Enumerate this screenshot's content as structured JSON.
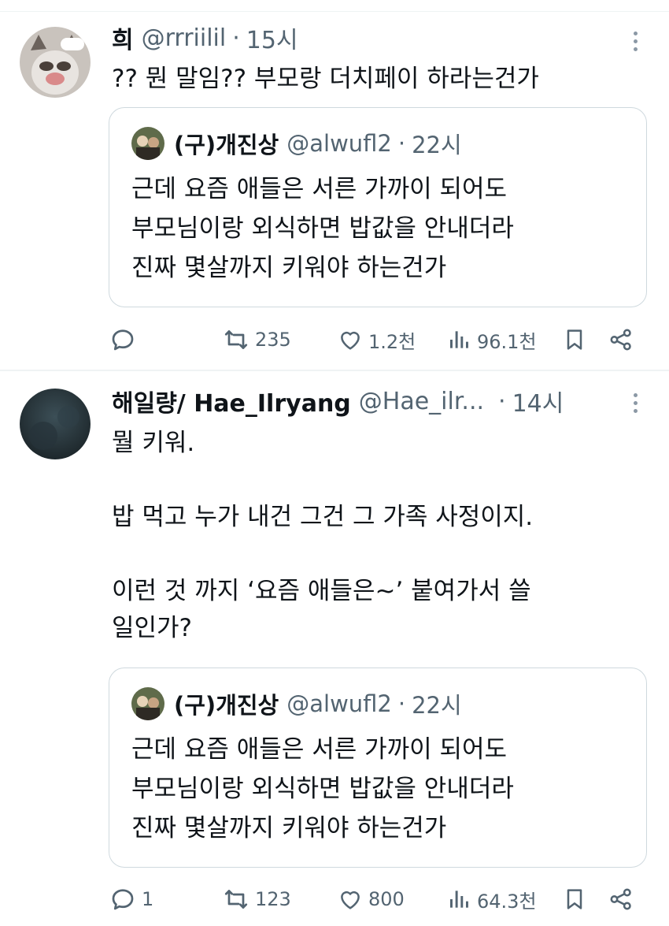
{
  "colors": {
    "text": "#0f1419",
    "secondary": "#536471",
    "border": "#cfd9de"
  },
  "tweets": [
    {
      "name": "희",
      "handle": "@rrriilil",
      "dot": "·",
      "time": "15시",
      "text": "?? 뭔 말임?? 부모랑 더치페이 하라는건가",
      "quote": {
        "name": "(구)개진상",
        "handle": "@alwufl2",
        "dot": "·",
        "time": "22시",
        "text": "근데 요즘 애들은 서른 가까이 되어도\n부모님이랑 외식하면 밥값을 안내더라\n진짜 몇살까지 키워야 하는건가"
      },
      "actions": {
        "reply": "",
        "retweet": "235",
        "like": "1.2천",
        "views": "96.1천"
      }
    },
    {
      "name": "해일량/ Hae_Ilryang",
      "handle": "@Hae_ilr...",
      "dot": "·",
      "time": "14시",
      "text": "뭘 키워.\n\n밥 먹고 누가 내건 그건 그 가족 사정이지.\n\n이런 것 까지 ‘요즘 애들은~’ 붙여가서 쓸\n일인가?",
      "quote": {
        "name": "(구)개진상",
        "handle": "@alwufl2",
        "dot": "·",
        "time": "22시",
        "text": "근데 요즘 애들은 서른 가까이 되어도\n부모님이랑 외식하면 밥값을 안내더라\n진짜 몇살까지 키워야 하는건가"
      },
      "actions": {
        "reply": "1",
        "retweet": "123",
        "like": "800",
        "views": "64.3천"
      }
    }
  ],
  "icons": [
    "more-icon",
    "reply-icon",
    "retweet-icon",
    "like-icon",
    "views-icon",
    "bookmark-icon",
    "share-icon"
  ]
}
